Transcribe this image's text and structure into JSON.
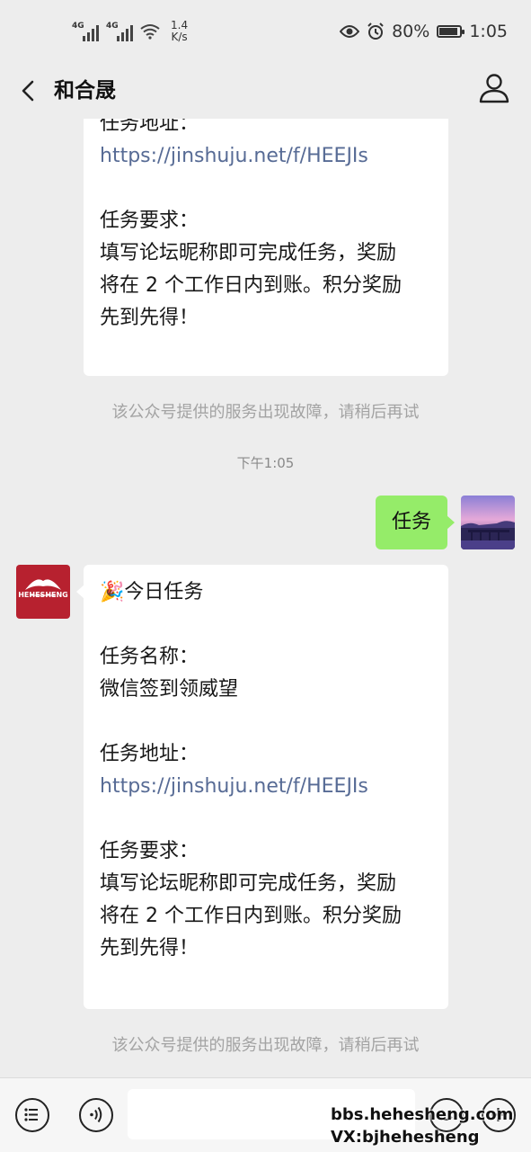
{
  "status_bar": {
    "net1": "4G",
    "net2": "4G",
    "speed_value": "1.4",
    "speed_unit": "K/s",
    "battery": "80%",
    "time": "1:05",
    "battery_level": 0.8
  },
  "header": {
    "title": "和合晟"
  },
  "messages": {
    "first_partial": {
      "address_label": "任务地址：",
      "address_link": "https://jinshuju.net/f/HEEJIs",
      "req_label": "任务要求：",
      "req_lines": [
        "填写论坛昵称即可完成任务，奖励",
        "将在 2 个工作日内到账。积分奖励",
        "先到先得！"
      ]
    },
    "system_notice_1": "该公众号提供的服务出现故障，请稍后再试",
    "timestamp": "下午1:05",
    "my_message": "任务",
    "task_card": {
      "emoji": "🎉",
      "heading": "今日任务",
      "name_label": "任务名称：",
      "name_value": "微信签到领威望",
      "address_label": "任务地址：",
      "address_link": "https://jinshuju.net/f/HEEJIs",
      "req_label": "任务要求：",
      "req_lines": [
        "填写论坛昵称即可完成任务，奖励",
        "将在 2 个工作日内到账。积分奖励",
        "先到先得！"
      ]
    },
    "system_notice_2": "该公众号提供的服务出现故障，请稍后再试",
    "brand_avatar_text": "HEHESHENG"
  },
  "watermark": {
    "line1": "bbs.hehesheng.com",
    "line2": "VX:bjhehesheng"
  },
  "icons": {
    "back": "chevron-left-icon",
    "profile": "person-icon",
    "menu": "list-icon",
    "voice": "voice-icon",
    "emoji": "smiley-icon",
    "plus": "plus-icon"
  }
}
